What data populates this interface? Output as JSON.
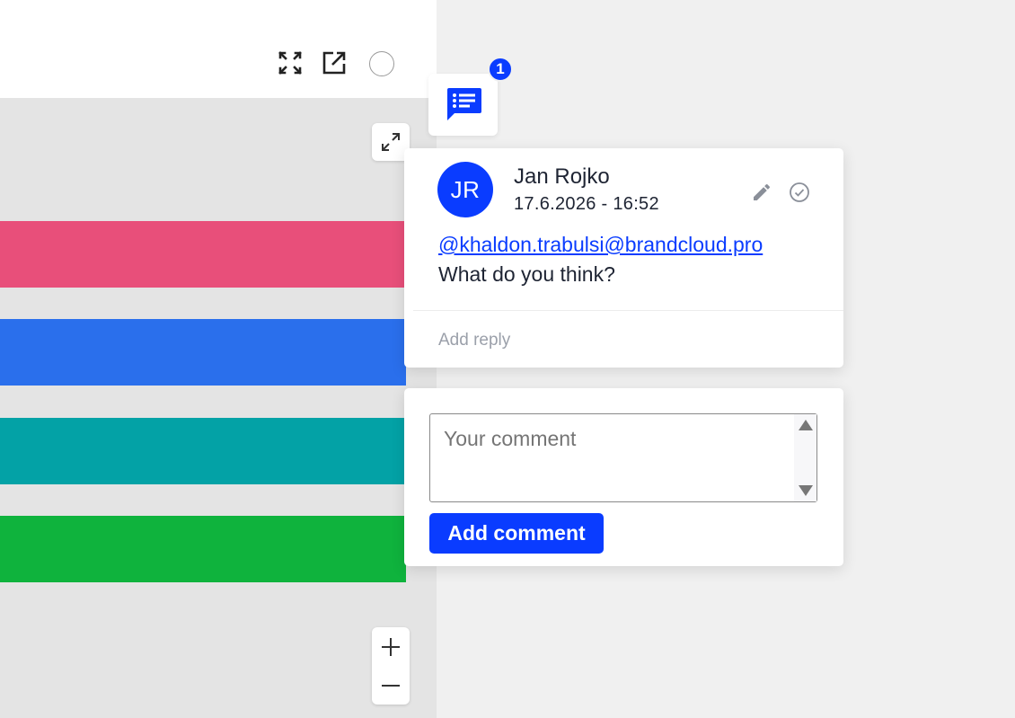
{
  "toolbar": {
    "icons": [
      "fullscreen-icon",
      "open-external-icon",
      "status-circle-icon"
    ]
  },
  "canvas": {
    "stripes": [
      {
        "color": "#e84f7a"
      },
      {
        "color": "#2a6fec"
      },
      {
        "color": "#03a2a6"
      },
      {
        "color": "#0fb33d"
      }
    ],
    "expand_icon": "expand-arrows-icon",
    "zoom_in_icon": "plus-icon",
    "zoom_out_icon": "minus-icon"
  },
  "comments_toggle": {
    "icon": "comment-list-icon",
    "badge_count": "1"
  },
  "thread": {
    "avatar_initials": "JR",
    "author": "Jan Rojko",
    "timestamp": "17.6.2026 - 16:52",
    "mention": "@khaldon.trabulsi@brandcloud.pro",
    "text": "What do you think?",
    "reply_placeholder": "Add reply",
    "edit_icon": "pencil-icon",
    "resolve_icon": "check-circle-icon"
  },
  "new_comment": {
    "placeholder": "Your comment",
    "button_label": "Add comment"
  },
  "colors": {
    "accent": "#0a3cff",
    "text": "#1e2433",
    "muted": "#9ba0aa"
  }
}
